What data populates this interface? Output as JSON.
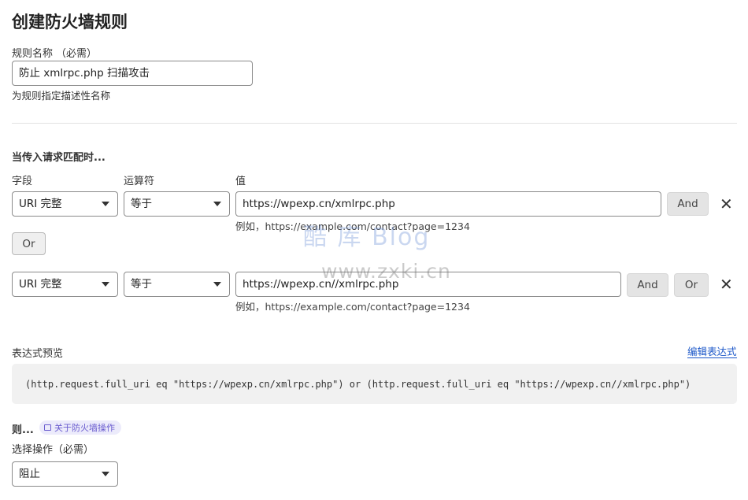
{
  "page": {
    "title": "创建防火墙规则"
  },
  "rule_name": {
    "label": "规则名称",
    "required": "（必需）",
    "value": "防止 xmlrpc.php 扫描攻击",
    "hint": "为规则指定描述性名称"
  },
  "match": {
    "heading": "当传入请求匹配时...",
    "col_field": "字段",
    "col_operator": "运算符",
    "col_value": "值",
    "rows": [
      {
        "field": "URI 完整",
        "operator": "等于",
        "value": "https://wpexp.cn/xmlrpc.php",
        "hint": "例如，https://example.com/contact?page=1234",
        "and_label": "And"
      },
      {
        "field": "URI 完整",
        "operator": "等于",
        "value": "https://wpexp.cn//xmlrpc.php",
        "hint": "例如，https://example.com/contact?page=1234",
        "and_label": "And",
        "or_label": "Or"
      }
    ],
    "or_label": "Or",
    "remove_icon": "close-icon"
  },
  "watermark": {
    "line1": "酷 库 Blog",
    "line2": "www.zxki.cn"
  },
  "expression": {
    "label": "表达式预览",
    "edit_link": "编辑表达式",
    "text": "(http.request.full_uri eq \"https://wpexp.cn/xmlrpc.php\") or (http.request.full_uri eq \"https://wpexp.cn//xmlrpc.php\")"
  },
  "action": {
    "heading": "则...",
    "help_pill": "关于防火墙操作",
    "help_icon": "book-icon",
    "label": "选择操作（必需）",
    "value": "阻止"
  },
  "colors": {
    "link": "#1a56c8",
    "pill_bg": "#ecebfb",
    "pill_text": "#6a5ccf"
  }
}
